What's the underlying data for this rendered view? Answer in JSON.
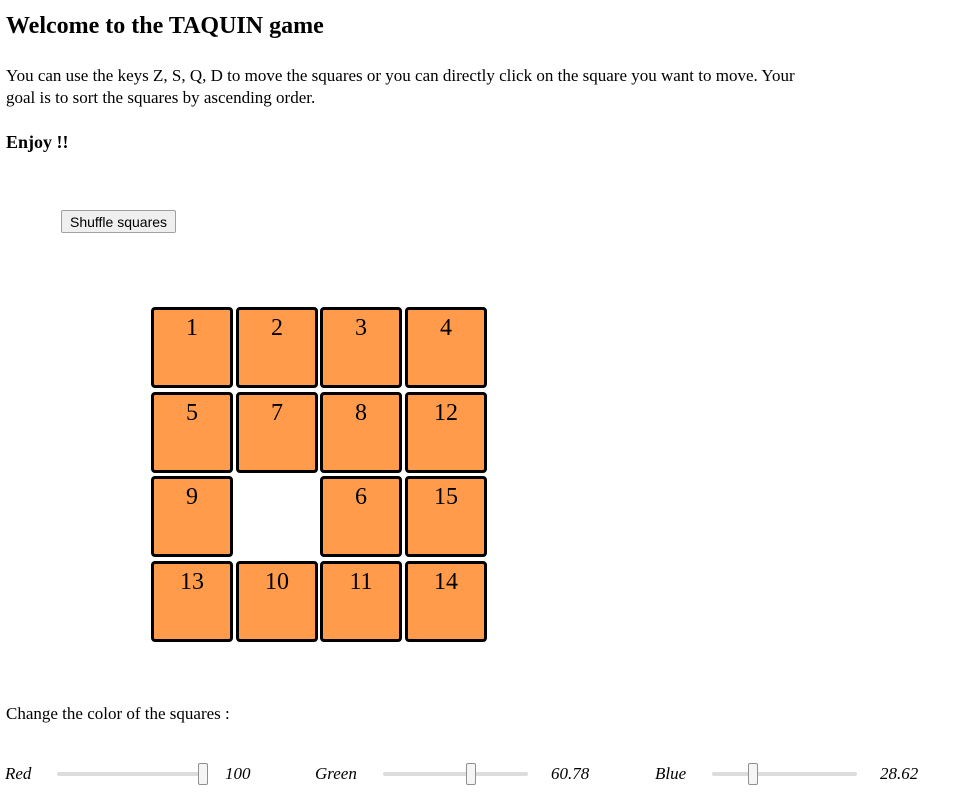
{
  "header": {
    "title": "Welcome to the TAQUIN game",
    "instructions": "You can use the keys Z, S, Q, D to move the squares or you can directly click on the square you want to move. Your goal is to sort the squares by ascending order.",
    "enjoy": "Enjoy !!"
  },
  "controls": {
    "shuffle_label": "Shuffle squares"
  },
  "board": {
    "rows": 4,
    "cols": 4,
    "tile_color": "#ff9b4a",
    "tiles": [
      [
        "1",
        "2",
        "3",
        "4"
      ],
      [
        "5",
        "7",
        "8",
        "12"
      ],
      [
        "9",
        "",
        "6",
        "15"
      ],
      [
        "13",
        "10",
        "11",
        "14"
      ]
    ]
  },
  "color_panel": {
    "label": "Change the color of the squares :",
    "sliders": [
      {
        "name": "Red",
        "value": "100",
        "fraction": 1.0
      },
      {
        "name": "Green",
        "value": "60.78",
        "fraction": 0.6078
      },
      {
        "name": "Blue",
        "value": "28.62",
        "fraction": 0.2862
      }
    ]
  }
}
